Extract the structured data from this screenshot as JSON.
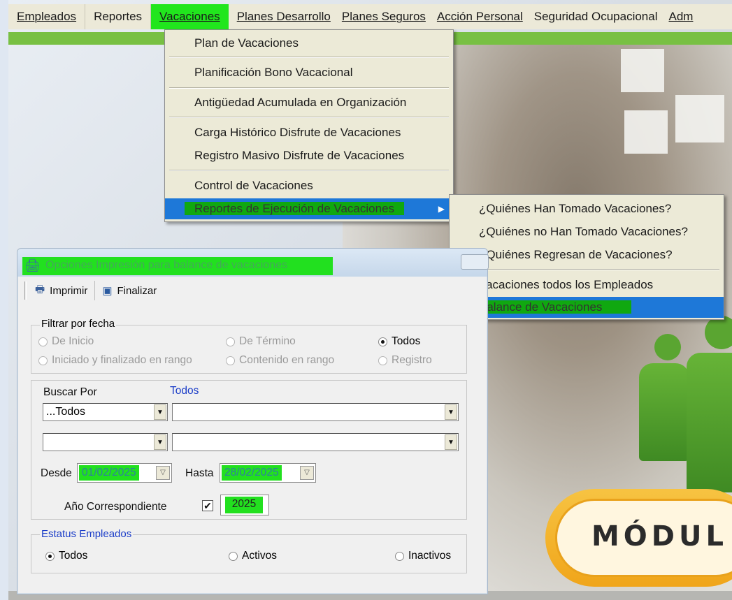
{
  "menubar": {
    "items": [
      {
        "label": "Empleados"
      },
      {
        "label": "Reportes"
      },
      {
        "label": "Vacaciones"
      },
      {
        "label": "Planes Desarrollo"
      },
      {
        "label": "Planes Seguros"
      },
      {
        "label": "Acción Personal"
      },
      {
        "label": "Seguridad Ocupacional"
      },
      {
        "label": "Adm"
      }
    ]
  },
  "vacaciones_menu": {
    "items": [
      {
        "label": "Plan de Vacaciones"
      },
      {
        "label": "Planificación Bono Vacacional"
      },
      {
        "label": "Antigüedad Acumulada en Organización"
      },
      {
        "label": "Carga Histórico Disfrute de Vacaciones"
      },
      {
        "label": "Registro Masivo Disfrute de Vacaciones"
      },
      {
        "label": "Control de Vacaciones"
      },
      {
        "label": "Reportes de Ejecución de Vacaciones"
      }
    ]
  },
  "reportes_submenu": {
    "items": [
      {
        "label": "¿Quiénes Han Tomado Vacaciones?"
      },
      {
        "label": "¿Quiénes no Han Tomado Vacaciones?"
      },
      {
        "label": "¿Quiénes Regresan de Vacaciones?"
      },
      {
        "label": "Vacaciones todos los Empleados"
      },
      {
        "label": "Balance de Vacaciones"
      }
    ]
  },
  "dialog": {
    "title": "Opciones Impresión para balance de vacaciones",
    "toolbar": {
      "print": "Imprimir",
      "finish": "Finalizar"
    },
    "filtro_fecha": {
      "legend": "Filtrar por fecha",
      "options": [
        "De Inicio",
        "De Término",
        "Todos",
        "Iniciado y finalizado en rango",
        "Contenido en rango",
        "Registro"
      ],
      "selected": "Todos"
    },
    "buscar": {
      "label": "Buscar Por",
      "label_value": "Todos",
      "combo1": "...Todos",
      "combo2": "",
      "combo3": "",
      "combo4": "",
      "desde_label": "Desde",
      "desde": "01/02/2025",
      "hasta_label": "Hasta",
      "hasta": "28/02/2025",
      "anio_label": "Año Correspondiente",
      "anio_checked": true,
      "anio": "2025"
    },
    "estatus": {
      "legend": "Estatus Empleados",
      "options": [
        "Todos",
        "Activos",
        "Inactivos"
      ],
      "selected": "Todos"
    }
  },
  "banner": {
    "text": "MÓDUL"
  },
  "colors": {
    "highlight": "#22e01f",
    "menu_selected": "#1e78d8",
    "menubar_bg": "#ece9d8",
    "accent_green": "#78c043"
  }
}
